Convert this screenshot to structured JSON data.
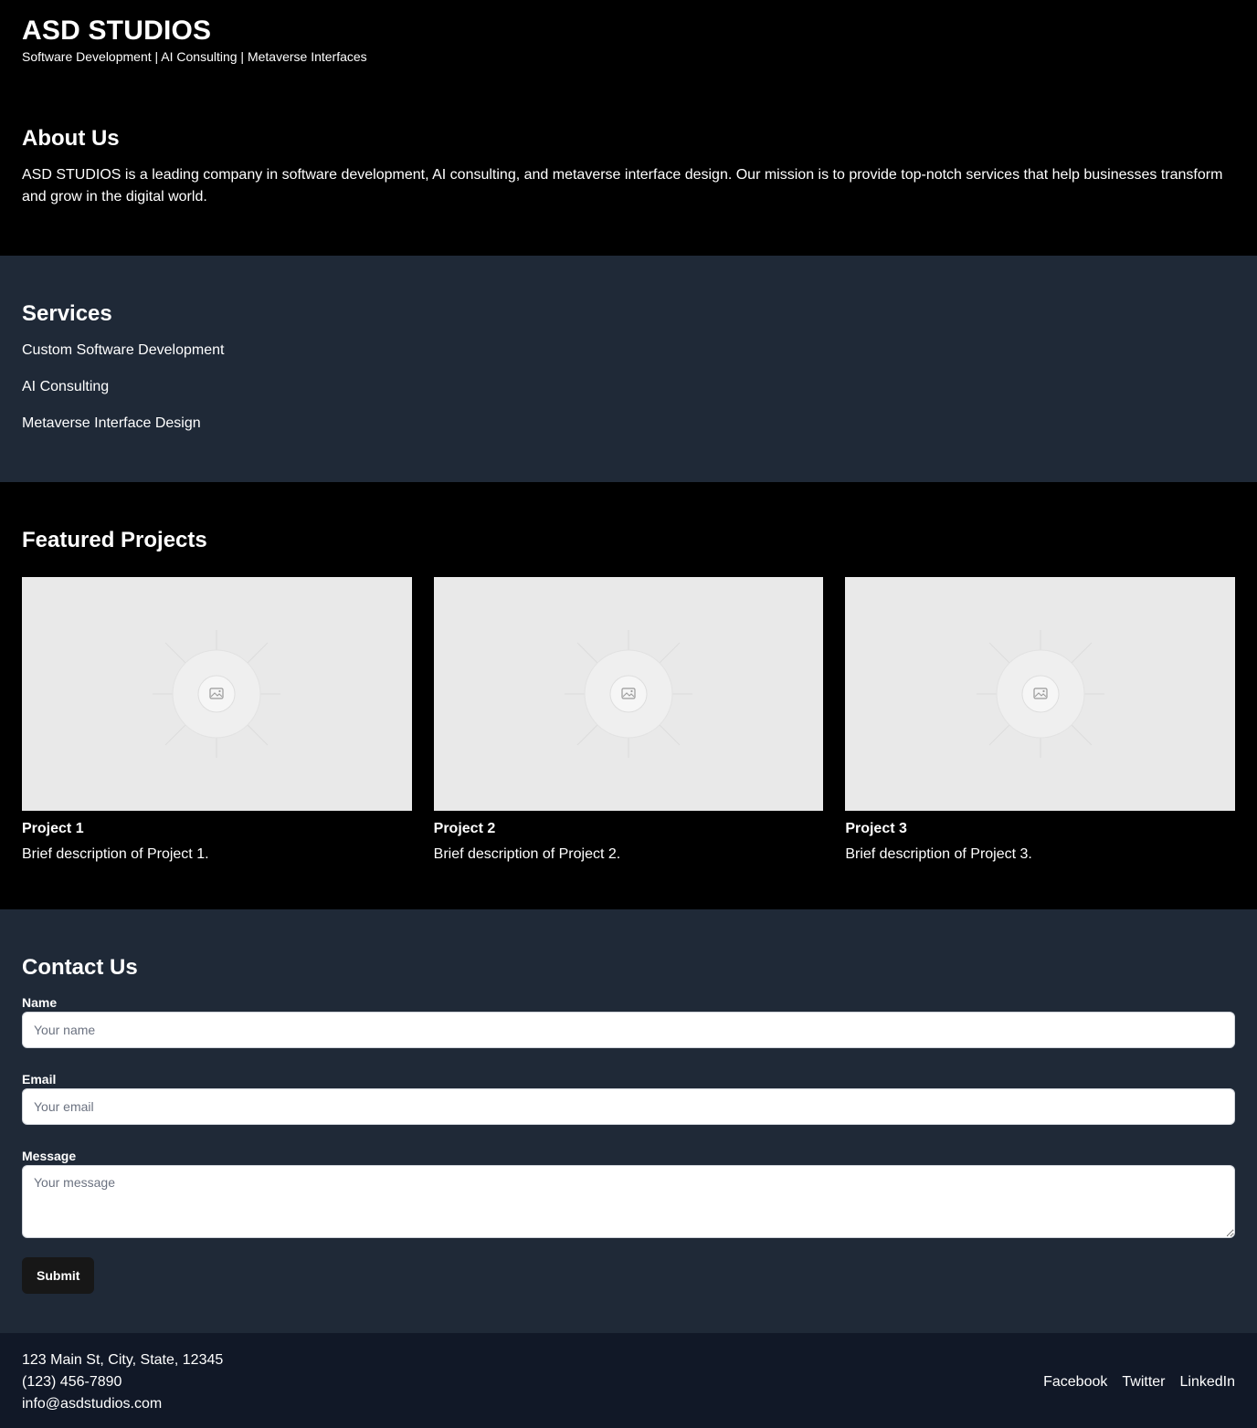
{
  "header": {
    "title": "ASD STUDIOS",
    "tagline": "Software Development | AI Consulting | Metaverse Interfaces"
  },
  "about": {
    "heading": "About Us",
    "text": "ASD STUDIOS is a leading company in software development, AI consulting, and metaverse interface design. Our mission is to provide top-notch services that help businesses transform and grow in the digital world."
  },
  "services": {
    "heading": "Services",
    "items": [
      "Custom Software Development",
      "AI Consulting",
      "Metaverse Interface Design"
    ]
  },
  "projects": {
    "heading": "Featured Projects",
    "items": [
      {
        "name": "Project 1",
        "description": "Brief description of Project 1.",
        "image_icon": "image-placeholder-icon"
      },
      {
        "name": "Project 2",
        "description": "Brief description of Project 2.",
        "image_icon": "image-placeholder-icon"
      },
      {
        "name": "Project 3",
        "description": "Brief description of Project 3.",
        "image_icon": "image-placeholder-icon"
      }
    ]
  },
  "contact": {
    "heading": "Contact Us",
    "name_label": "Name",
    "name_placeholder": "Your name",
    "email_label": "Email",
    "email_placeholder": "Your email",
    "message_label": "Message",
    "message_placeholder": "Your message",
    "submit_label": "Submit"
  },
  "footer": {
    "address": "123 Main St, City, State, 12345",
    "phone": "(123) 456-7890",
    "email": "info@asdstudios.com",
    "links": [
      "Facebook",
      "Twitter",
      "LinkedIn"
    ]
  },
  "colors": {
    "dark_background": "#000000",
    "slate_background": "#1f2937",
    "footer_background": "#111827",
    "submit_button": "#171717",
    "placeholder_image": "#e9e9e9"
  }
}
